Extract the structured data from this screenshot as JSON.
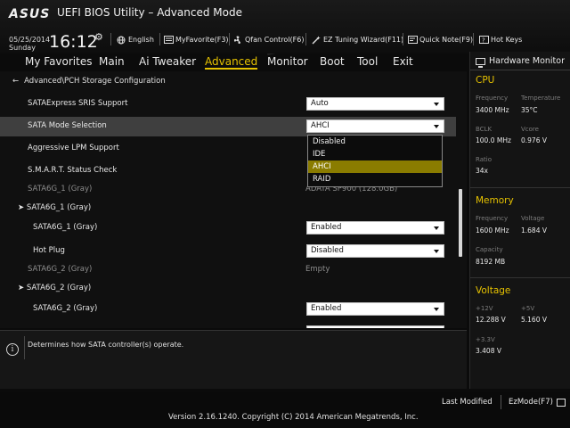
{
  "header": {
    "logo": "ASUS",
    "title": "UEFI BIOS Utility – Advanced Mode",
    "date": "05/25/2014",
    "day": "Sunday",
    "time": "16:12",
    "language": "English",
    "my_favorite": "MyFavorite(F3)",
    "qfan": "Qfan Control(F6)",
    "ez_tuning": "EZ Tuning Wizard(F11)",
    "quick_note": "Quick Note(F9)",
    "hot_keys": "Hot Keys"
  },
  "menu": {
    "items": [
      "My Favorites",
      "Main",
      "Ai Tweaker",
      "Advanced",
      "Monitor",
      "Boot",
      "Tool",
      "Exit"
    ],
    "active": "Advanced"
  },
  "breadcrumb": "Advanced\\PCH Storage Configuration",
  "settings": [
    {
      "label": "SATAExpress SRIS Support",
      "value": "Auto"
    },
    {
      "label": "SATA Mode Selection",
      "value": "AHCI"
    },
    {
      "label": "Aggressive LPM Support"
    },
    {
      "label": "S.M.A.R.T. Status Check"
    },
    {
      "label": "SATA6G_1 (Gray)",
      "info": "ADATA SP900 (128.0GB)"
    },
    {
      "label": "SATA6G_1 (Gray)"
    },
    {
      "label": "SATA6G_1 (Gray)",
      "value": "Enabled"
    },
    {
      "label": "Hot Plug",
      "value": "Disabled"
    },
    {
      "label": "SATA6G_2 (Gray)",
      "info": "Empty"
    },
    {
      "label": "SATA6G_2 (Gray)"
    },
    {
      "label": "SATA6G_2 (Gray)",
      "value": "Enabled"
    }
  ],
  "dropdown": {
    "options": [
      "Disabled",
      "IDE",
      "AHCI",
      "RAID"
    ],
    "selected": "AHCI"
  },
  "help": "Determines how SATA controller(s) operate.",
  "hardware_monitor": {
    "title": "Hardware Monitor",
    "cpu": {
      "title": "CPU",
      "frequency_label": "Frequency",
      "frequency": "3400 MHz",
      "temperature_label": "Temperature",
      "temperature": "35°C",
      "bclk_label": "BCLK",
      "bclk": "100.0 MHz",
      "vcore_label": "Vcore",
      "vcore": "0.976 V",
      "ratio_label": "Ratio",
      "ratio": "34x"
    },
    "memory": {
      "title": "Memory",
      "frequency_label": "Frequency",
      "frequency": "1600 MHz",
      "voltage_label": "Voltage",
      "voltage": "1.684 V",
      "capacity_label": "Capacity",
      "capacity": "8192 MB"
    },
    "voltage": {
      "title": "Voltage",
      "v12_label": "+12V",
      "v12": "12.288 V",
      "v5_label": "+5V",
      "v5": "5.160 V",
      "v33_label": "+3.3V",
      "v33": "3.408 V"
    }
  },
  "footer": {
    "last_modified": "Last Modified",
    "ez_mode": "EzMode(F7)",
    "version": "Version 2.16.1240. Copyright (C) 2014 American Megatrends, Inc."
  },
  "colors": {
    "accent": "#e6c200",
    "selected_option": "#8a7c00",
    "row_highlight": "#3f3f3f"
  }
}
